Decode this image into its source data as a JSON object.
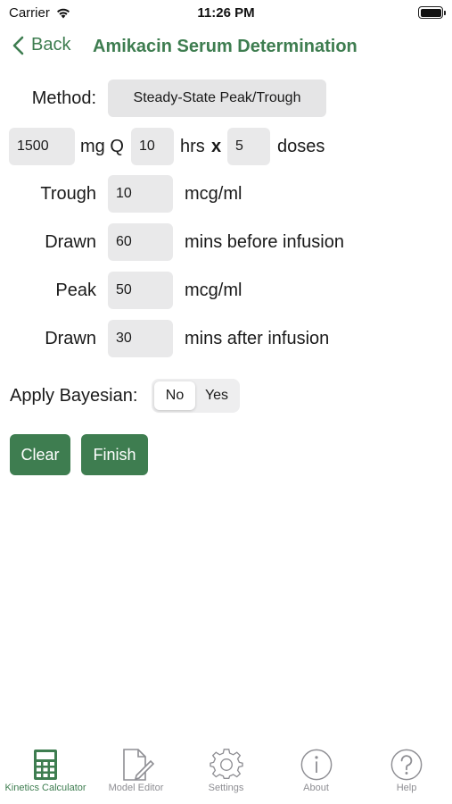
{
  "status": {
    "carrier": "Carrier",
    "time": "11:26 PM"
  },
  "nav": {
    "back_label": "Back",
    "title": "Amikacin Serum Determination"
  },
  "method": {
    "label": "Method:",
    "value": "Steady-State Peak/Trough"
  },
  "dosing": {
    "dose": "1500",
    "dose_unit": "mg Q",
    "interval": "10",
    "interval_unit": "hrs",
    "times": "x",
    "doses": "5",
    "doses_unit": "doses"
  },
  "trough": {
    "label": "Trough",
    "value": "10",
    "unit": "mcg/ml"
  },
  "trough_drawn": {
    "label": "Drawn",
    "value": "60",
    "unit": "mins before infusion"
  },
  "peak": {
    "label": "Peak",
    "value": "50",
    "unit": "mcg/ml"
  },
  "peak_drawn": {
    "label": "Drawn",
    "value": "30",
    "unit": "mins after infusion"
  },
  "bayesian": {
    "label": "Apply Bayesian:",
    "options": [
      "No",
      "Yes"
    ],
    "selected": "No"
  },
  "buttons": {
    "clear": "Clear",
    "finish": "Finish"
  },
  "tabs": [
    {
      "label": "Kinetics Calculator",
      "icon": "calculator-icon",
      "active": true
    },
    {
      "label": "Model Editor",
      "icon": "document-edit-icon",
      "active": false
    },
    {
      "label": "Settings",
      "icon": "gear-icon",
      "active": false
    },
    {
      "label": "About",
      "icon": "info-icon",
      "active": false
    },
    {
      "label": "Help",
      "icon": "help-icon",
      "active": false
    }
  ],
  "colors": {
    "accent": "#3e7d50",
    "field_bg": "#e9e9ea",
    "inactive": "#8e8e93"
  }
}
